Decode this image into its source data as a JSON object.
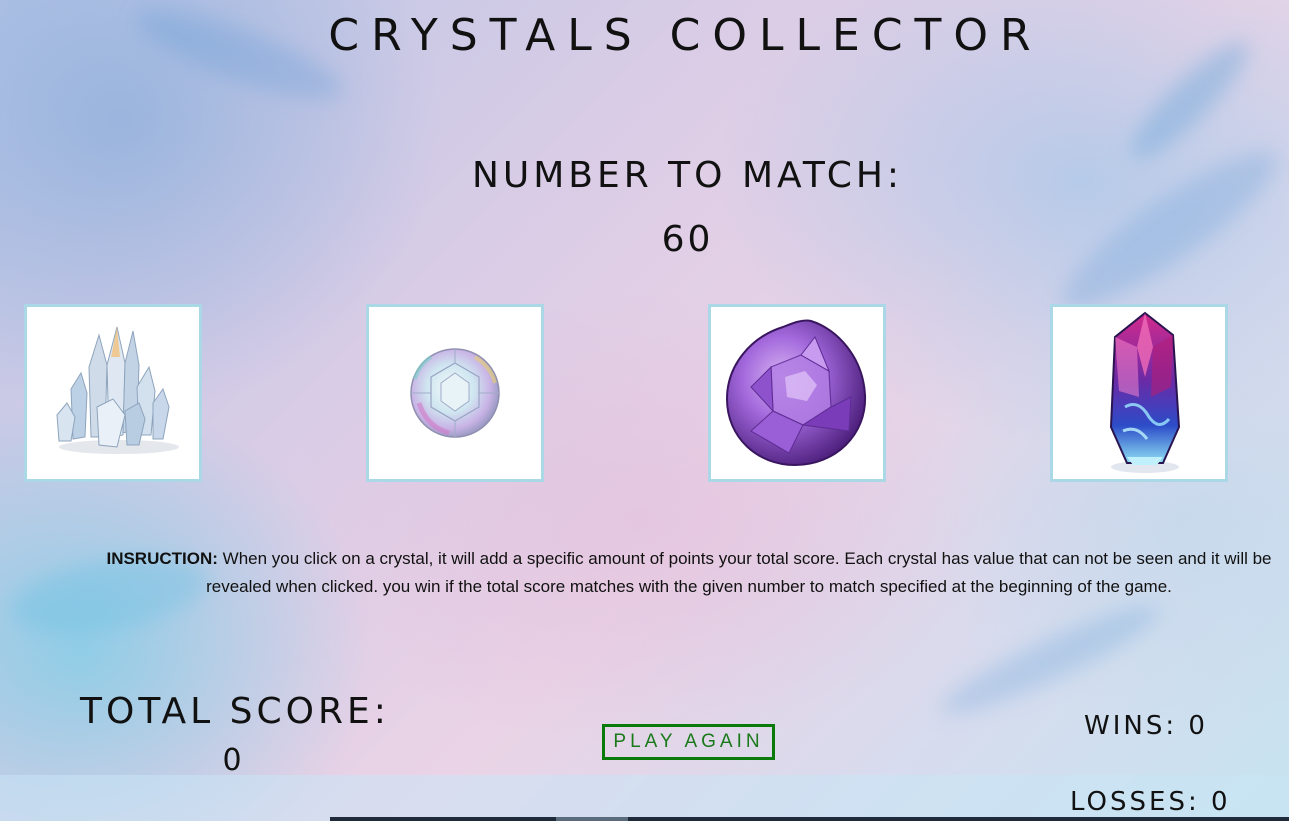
{
  "title": "CRYSTALS COLLECTOR",
  "target": {
    "label": "NUMBER TO MATCH:",
    "value": "60"
  },
  "crystals": [
    {
      "name": "clear-quartz-cluster"
    },
    {
      "name": "iridescent-round-gem"
    },
    {
      "name": "amethyst-faceted-drop"
    },
    {
      "name": "blue-pink-crystal-point"
    }
  ],
  "instructions": {
    "label": "INSRUCTION:",
    "text": " When you click on a crystal, it will add a specific amount of points your total score. Each crystal has value that can not be seen and it will be revealed when clicked. you win if the total score matches with the given number to match specified at the beginning of the game."
  },
  "score": {
    "label": "TOTAL SCORE:",
    "value": "0"
  },
  "play_again_label": "PLAY AGAIN",
  "wins_text": "WINS: 0",
  "losses_text": "LOSSES: 0",
  "colors": {
    "play_again": "#0a7a0a",
    "crystal_border": "#abd8e6"
  }
}
